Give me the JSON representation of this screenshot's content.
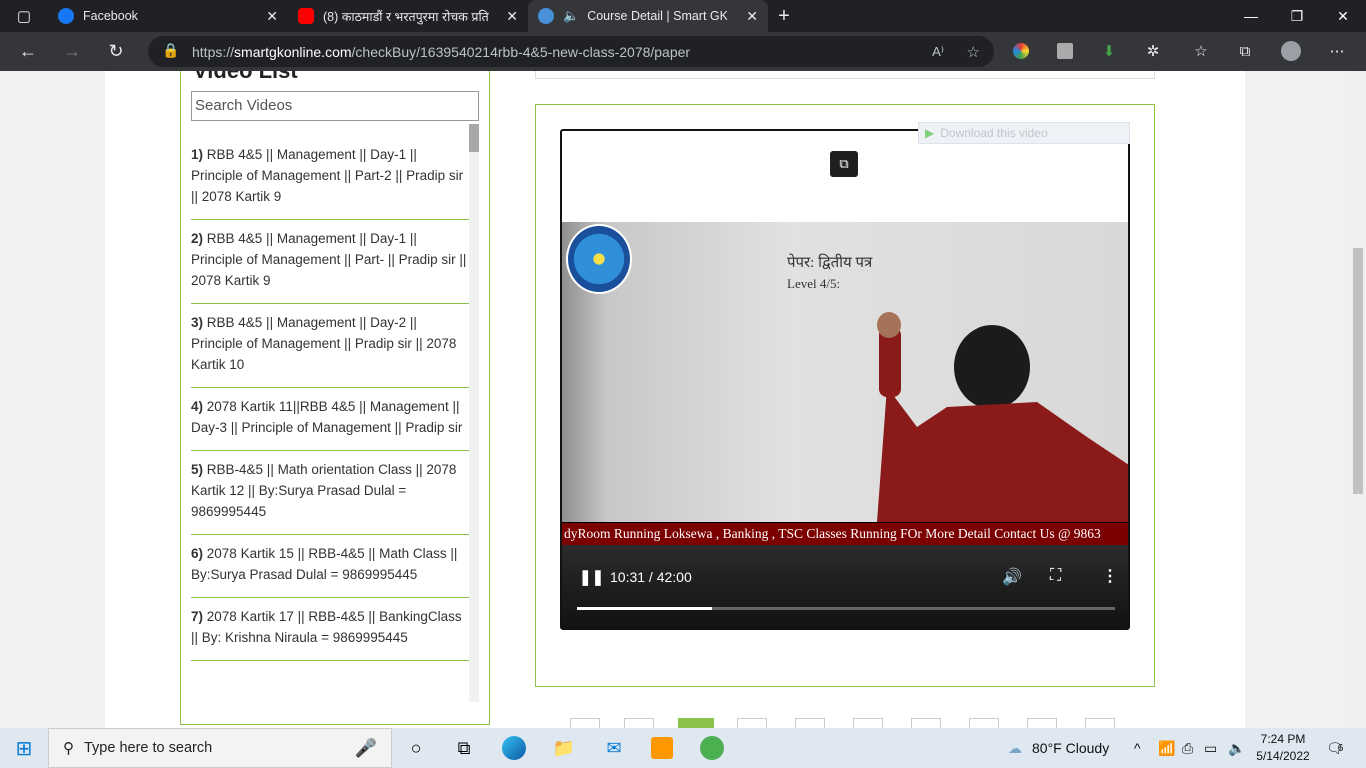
{
  "tabs": [
    {
      "title": "Facebook",
      "icon": "facebook-icon",
      "color": "#1877f2"
    },
    {
      "title": "(8) काठमाडौं र भरतपुरमा रोचक प्रति",
      "icon": "youtube-icon",
      "color": "#ff0000"
    },
    {
      "title": "Course Detail | Smart GK",
      "icon": "site-icon",
      "color": "#4a90d9"
    }
  ],
  "address": {
    "scheme": "https://",
    "host": "smartgkonline.com",
    "path": "/checkBuy/1639540214rbb-4&5-new-class-2078/paper"
  },
  "sidebar": {
    "heading": "Video List",
    "search_placeholder": "Search Videos",
    "items": [
      {
        "num": "1)",
        "title": "RBB 4&5 || Management || Day-1 || Principle of Management || Part-2 || Pradip sir || 2078 Kartik 9"
      },
      {
        "num": "2)",
        "title": "RBB 4&5 || Management || Day-1 || Principle of Management || Part- || Pradip sir || 2078 Kartik 9"
      },
      {
        "num": "3)",
        "title": "RBB 4&5 || Management || Day-2 || Principle of Management || Pradip sir || 2078 Kartik 10"
      },
      {
        "num": "4)",
        "title": "2078 Kartik 11||RBB 4&5 || Management || Day-3 || Principle of Management || Pradip sir"
      },
      {
        "num": "5)",
        "title": "RBB-4&5 || Math orientation Class || 2078 Kartik 12 || By:Surya Prasad Dulal = 9869995445"
      },
      {
        "num": "6)",
        "title": "2078 Kartik 15 || RBB-4&5 || Math Class || By:Surya Prasad Dulal = 9869995445"
      },
      {
        "num": "7)",
        "title": "2078 Kartik 17 || RBB-4&5 || BankingClass || By: Krishna Niraula = 9869995445"
      }
    ]
  },
  "player": {
    "download_label": "Download this video",
    "ticker": "dyRoom Running Loksewa , Banking , TSC Classes Running FOr More Detail Contact Us @ 9863",
    "time": "10:31 / 42:00",
    "progress": 0.25,
    "board_line1": "पेपर: द्वितीय पत्र",
    "board_line2": "Level 4/5:"
  },
  "taskbar": {
    "search_placeholder": "Type here to search",
    "weather": "80°F  Cloudy",
    "time": "7:24 PM",
    "date": "5/14/2022",
    "notifications": "6"
  }
}
